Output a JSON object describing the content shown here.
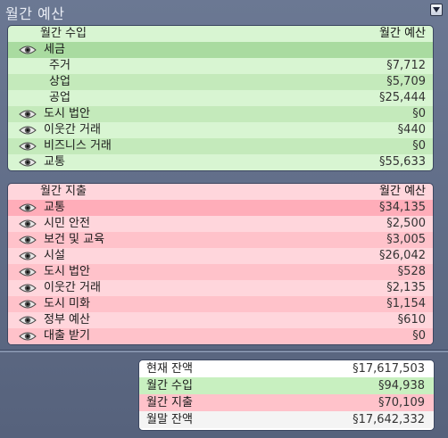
{
  "title": "월간 예산",
  "income": {
    "header_label": "월간 수입",
    "header_value": "월간 예산",
    "rows": [
      {
        "label": "세금",
        "value": "",
        "eye": true,
        "sub": false
      },
      {
        "label": "주거",
        "value": "§7,712",
        "eye": false,
        "sub": true
      },
      {
        "label": "상업",
        "value": "§5,709",
        "eye": false,
        "sub": true
      },
      {
        "label": "공업",
        "value": "§25,444",
        "eye": false,
        "sub": true
      },
      {
        "label": "도시 법안",
        "value": "§0",
        "eye": true,
        "sub": false
      },
      {
        "label": "이웃간 거래",
        "value": "§440",
        "eye": true,
        "sub": false
      },
      {
        "label": "비즈니스 거래",
        "value": "§0",
        "eye": true,
        "sub": false
      },
      {
        "label": "교통",
        "value": "§55,633",
        "eye": true,
        "sub": false
      }
    ]
  },
  "expense": {
    "header_label": "월간 지출",
    "header_value": "월간 예산",
    "rows": [
      {
        "label": "교통",
        "value": "§34,135"
      },
      {
        "label": "시민 안전",
        "value": "§2,500"
      },
      {
        "label": "보건 및 교육",
        "value": "§3,005"
      },
      {
        "label": "시설",
        "value": "§26,042"
      },
      {
        "label": "도시 법안",
        "value": "§528"
      },
      {
        "label": "이웃간 거래",
        "value": "§2,135"
      },
      {
        "label": "도시 미화",
        "value": "§1,154"
      },
      {
        "label": "정부 예산",
        "value": "§610"
      },
      {
        "label": "대출 받기",
        "value": "§0"
      }
    ]
  },
  "summary": {
    "current_balance_label": "현재 잔액",
    "current_balance_value": "§17,617,503",
    "monthly_income_label": "월간 수입",
    "monthly_income_value": "§94,938",
    "monthly_expense_label": "월간 지출",
    "monthly_expense_value": "§70,109",
    "end_balance_label": "월말 잔액",
    "end_balance_value": "§17,642,332"
  },
  "colors": {
    "income_bg": "#d8f5d2",
    "expense_bg": "#ffd6dc",
    "panel_bg": "#5c6a86"
  }
}
